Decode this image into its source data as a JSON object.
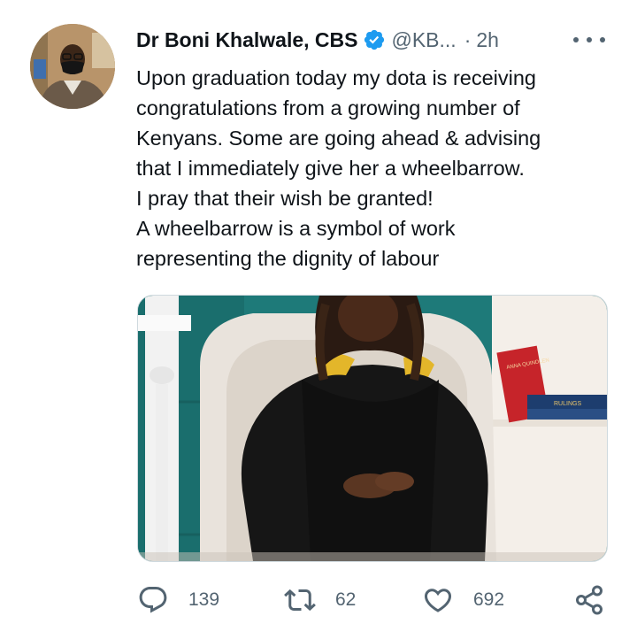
{
  "tweet": {
    "author": {
      "display_name": "Dr Boni Khalwale, CBS",
      "handle": "@KB...",
      "verified": true,
      "avatar_icon": "profile-photo"
    },
    "separator": "·",
    "time": "2h",
    "more_icon": "more-horizontal-icon",
    "text_lines": [
      "Upon graduation today my dota is receiving",
      "congratulations from a growing number of",
      "Kenyans. Some are going ahead & advising",
      "that I immediately give her a wheelbarrow.",
      "I pray that their wish be granted!",
      "A wheelbarrow is a symbol of work",
      "representing the dignity of labour"
    ],
    "media": {
      "kind": "photo",
      "book_spines": [
        "ANNA QUINDLEN",
        "RULINGS"
      ]
    },
    "actions": {
      "reply": {
        "icon": "reply-icon",
        "count": "139"
      },
      "retweet": {
        "icon": "retweet-icon",
        "count": "62"
      },
      "like": {
        "icon": "heart-icon",
        "count": "692"
      },
      "share": {
        "icon": "share-icon"
      }
    },
    "colors": {
      "text": "#0f1419",
      "secondary": "#536471",
      "verified_blue": "#1d9bf0",
      "border": "#cfd9de"
    }
  }
}
